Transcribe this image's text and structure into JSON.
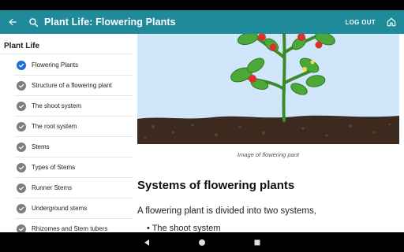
{
  "app_bar": {
    "title": "Plant Life: Flowering Plants",
    "logout_label": "LOG OUT",
    "icons": [
      "back-arrow-icon",
      "search-icon",
      "home-icon"
    ]
  },
  "sidebar": {
    "header": "Plant Life",
    "items": [
      {
        "label": "Flowering Plants",
        "status": "active"
      },
      {
        "label": "Structure of a flowering plant",
        "status": "done"
      },
      {
        "label": "The shoot system",
        "status": "done"
      },
      {
        "label": "The root system",
        "status": "done"
      },
      {
        "label": "Stems",
        "status": "done"
      },
      {
        "label": "Types of Stems",
        "status": "done"
      },
      {
        "label": "Runner Stems",
        "status": "done"
      },
      {
        "label": "Underground stems",
        "status": "done"
      },
      {
        "label": "Rhizomes and Stem tubers",
        "status": "done"
      }
    ]
  },
  "main": {
    "caption": "Image of flowering pant",
    "heading": "Systems of flowering plants",
    "paragraph": "A flowering plant is divided into two systems,",
    "bullet": "• The shoot system"
  },
  "colors": {
    "app_bar": "#1f8a9a",
    "active_check": "#1e6fd6",
    "done_check": "#7d7d7d",
    "sky": "#cfe6fb",
    "soil": "#3a2a1d"
  }
}
